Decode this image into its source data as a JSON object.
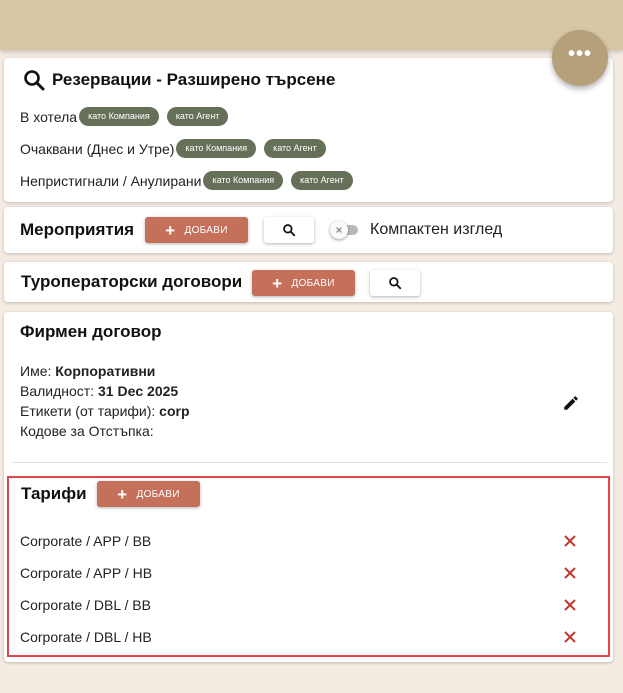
{
  "fab": {
    "label": "•••"
  },
  "reservations": {
    "title": "Резервации - Разширено търсене",
    "rows": [
      {
        "label": "В хотела",
        "chip_company": "като Компания",
        "chip_agent": "като Агент"
      },
      {
        "label": "Очаквани (Днес и Утре)",
        "chip_company": "като Компания",
        "chip_agent": "като Агент"
      },
      {
        "label": "Непристигнали / Анулирани",
        "chip_company": "като Компания",
        "chip_agent": "като Агент"
      }
    ]
  },
  "events": {
    "title": "Мероприятия",
    "add_label": "ДОБАВИ",
    "compact_label": "Компактен изглед"
  },
  "tour_contracts": {
    "title": "Туроператорски договори",
    "add_label": "ДОБАВИ"
  },
  "company_contract": {
    "title": "Фирмен договор",
    "name_label": "Име:",
    "name_value": "Корпоративни",
    "validity_label": "Валидност:",
    "validity_value": "31 Dec 2025",
    "tags_label": "Етикети (от тарифи):",
    "tags_value": "corp",
    "codes_label": "Кодове за Отстъпка:"
  },
  "tariffs": {
    "title": "Тарифи",
    "add_label": "ДОБАВИ",
    "items": [
      "Corporate / APP / BB",
      "Corporate / APP / HB",
      "Corporate / DBL / BB",
      "Corporate / DBL / HB"
    ]
  },
  "colors": {
    "accent": "#c4705a",
    "chip": "#667059",
    "highlight": "#e0474c",
    "topbar": "#d8c7a4",
    "fab": "#b6a07a"
  }
}
